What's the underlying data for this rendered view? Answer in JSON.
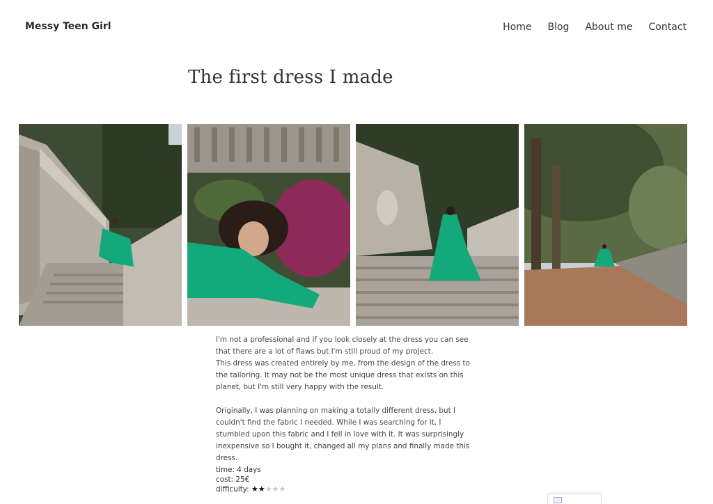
{
  "header": {
    "site_title": "Messy Teen Girl",
    "nav": [
      {
        "label": "Home"
      },
      {
        "label": "Blog"
      },
      {
        "label": "About me"
      },
      {
        "label": "Contact"
      }
    ]
  },
  "post": {
    "title": "The first dress I made",
    "paragraphs": [
      "I'm not a professional and if you look closely at the dress you can see that there are a lot of flaws but I'm still proud of my project.",
      "This dress was created entirely by me, from the design of the dress to the tailoring. It may not be the most unique dress that exists on this planet, but I'm still very happy with the result.",
      "Originally, I was planning on making a totally different dress, but I couldn't find the fabric I needed. While I was searching for it, I stumbled upon this fabric and I fell in love with it. It was surprisingly inexpensive so I bought it, changed all my plans and finally made this dress."
    ],
    "meta": {
      "time": "time: 4 days",
      "cost": "cost: 25€",
      "difficulty_label": "difficulty:",
      "difficulty_rating": 2,
      "difficulty_max": 5
    }
  },
  "gallery": [
    {
      "subject": "green dress on stone staircase"
    },
    {
      "subject": "girl in green dress leaning on balustrade"
    },
    {
      "subject": "green dress walking up stairs"
    },
    {
      "subject": "green dress on tree-lined path"
    }
  ],
  "colors": {
    "dress_green": "#13a97a",
    "stone": "#b9b3aa",
    "foliage": "#2f3f28"
  }
}
